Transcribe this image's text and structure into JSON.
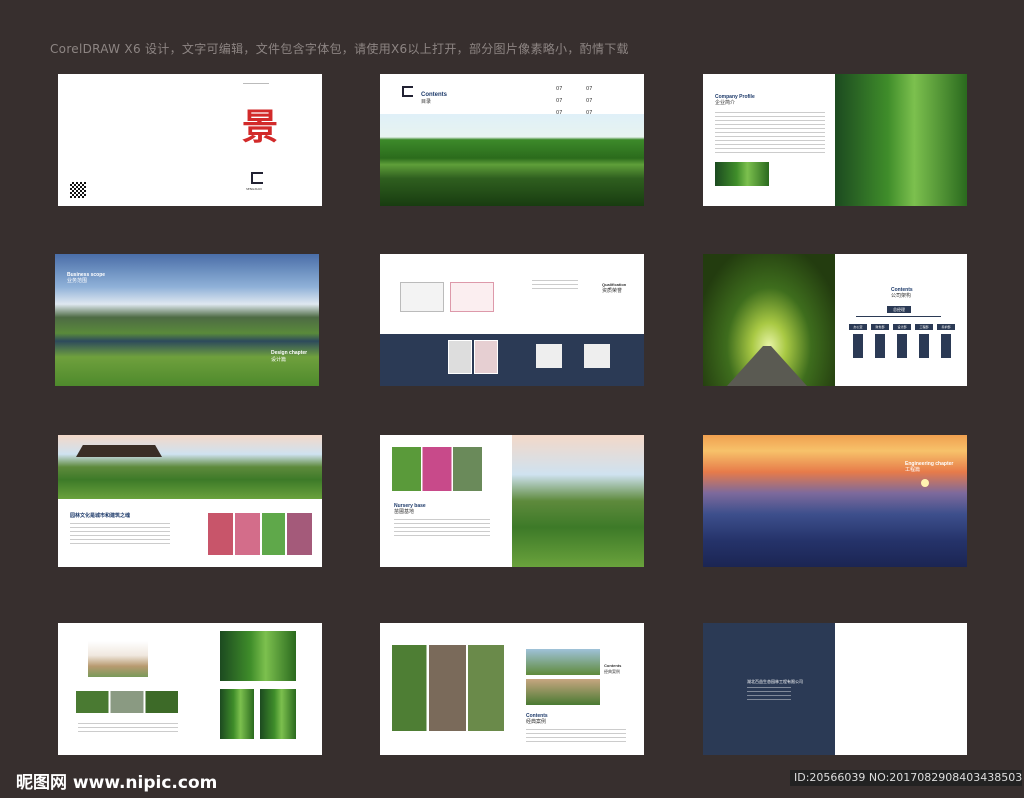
{
  "header": {
    "note": "CorelDRAW X6 设计，文字可编辑，文件包含字体包，请使用X6以上打开，部分图片像素略小，酌情下载"
  },
  "cover": {
    "seal_char": "景",
    "brand": "SENGXIAN"
  },
  "contents": {
    "title_en": "Contents",
    "title_cn": "目录",
    "nums": [
      "07",
      "07",
      "07",
      "07",
      "07",
      "07"
    ]
  },
  "profile": {
    "title_en": "Company Profile",
    "title_cn": "企业简介"
  },
  "business": {
    "title_en": "Business scope",
    "title_cn": "业务范围",
    "design_en": "Design chapter",
    "design_cn": "设计篇"
  },
  "qualification": {
    "title_en": "Qualification",
    "title_cn": "资质荣誉"
  },
  "structure": {
    "title_en": "Contents",
    "title_cn": "公司架构",
    "top": "总经理",
    "branches": [
      "办公室",
      "财务部",
      "设计部",
      "工程部",
      "养护部"
    ]
  },
  "culture": {
    "heading": "园林文化是城市和建筑之魂"
  },
  "nursery": {
    "title_en": "Nursery base",
    "title_cn": "苗圃基地"
  },
  "engineering": {
    "title_en": "Engineering chapter",
    "title_cn": "工程篇"
  },
  "cases": {
    "title_en": "Contents",
    "title_cn": "经典案例",
    "small_en": "Contents",
    "small_cn": "经典案例"
  },
  "back": {
    "company": "湖北百益生态园林工程有限公司"
  },
  "footer": {
    "logo_text": "昵图网 www.nipic.com",
    "id_text": "ID:20566039 NO:20170829084034385033"
  },
  "colors": {
    "bg": "#372f2e",
    "seal": "#d22a2a",
    "navy": "#2b3a55"
  }
}
